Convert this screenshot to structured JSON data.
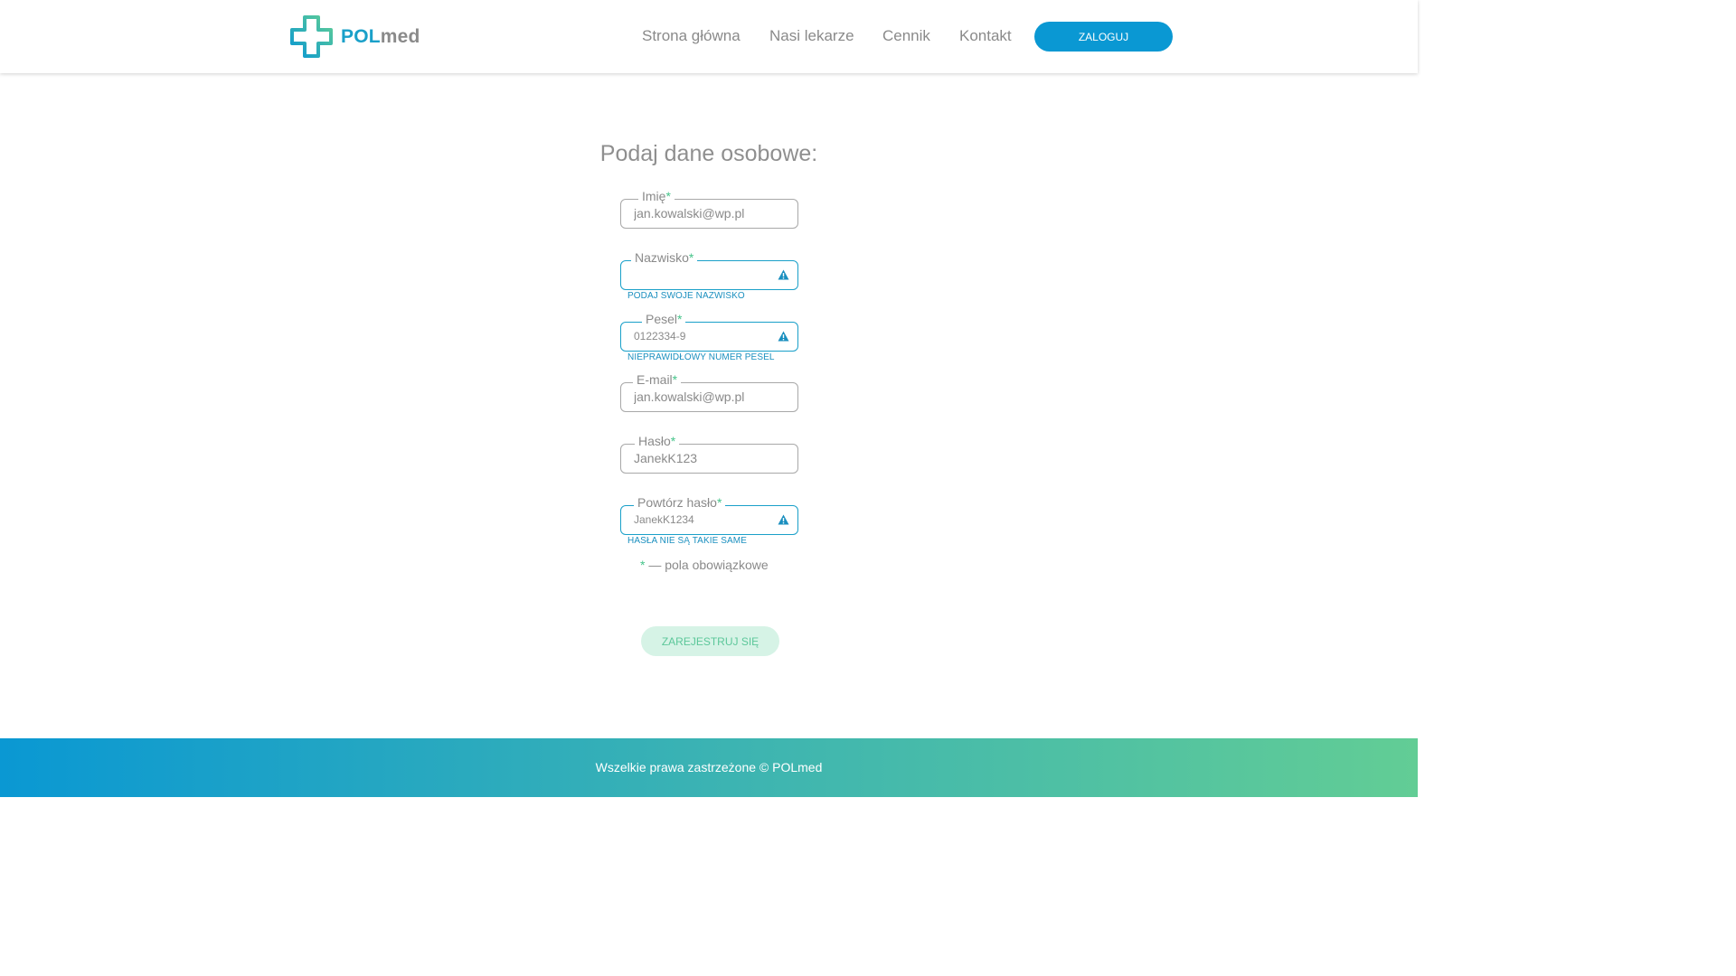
{
  "brand": {
    "name_part1": "POL",
    "name_part2": "med"
  },
  "nav": {
    "items": [
      {
        "label": "Strona główna"
      },
      {
        "label": "Nasi lekarze"
      },
      {
        "label": "Cennik"
      },
      {
        "label": "Kontakt"
      }
    ],
    "login_label": "ZALOGUJ"
  },
  "form": {
    "title": "Podaj dane osobowe:",
    "required_mark": "*",
    "fields": [
      {
        "label": "Imię",
        "value": "jan.kowalski@wp.pl",
        "error": ""
      },
      {
        "label": "Nazwisko",
        "value": "",
        "error": "PODAJ SWOJE NAZWISKO"
      },
      {
        "label": "Pesel",
        "value": "0122334-9",
        "error": "NIEPRAWIDŁOWY NUMER PESEL"
      },
      {
        "label": "E-mail",
        "value": "jan.kowalski@wp.pl",
        "error": ""
      },
      {
        "label": "Hasło",
        "value": "JanekK123",
        "error": ""
      },
      {
        "label": "Powtórz hasło",
        "value": "JanekK1234",
        "error": "HASŁA NIE SĄ TAKIE SAME"
      }
    ],
    "required_note": "— pola obowiązkowe",
    "submit_label": "ZAREJESTRUJ SIĘ"
  },
  "footer": {
    "text": "Wszelkie prawa zastrzeżone © POLmed"
  },
  "colors": {
    "primary_blue": "#0a98d3",
    "accent_green": "#46c48a",
    "error_blue": "#1aa0c9",
    "submit_disabled_bg": "#d6f3e6"
  },
  "icons": {
    "logo": "medical-cross-icon",
    "warning": "warning-triangle-icon"
  }
}
